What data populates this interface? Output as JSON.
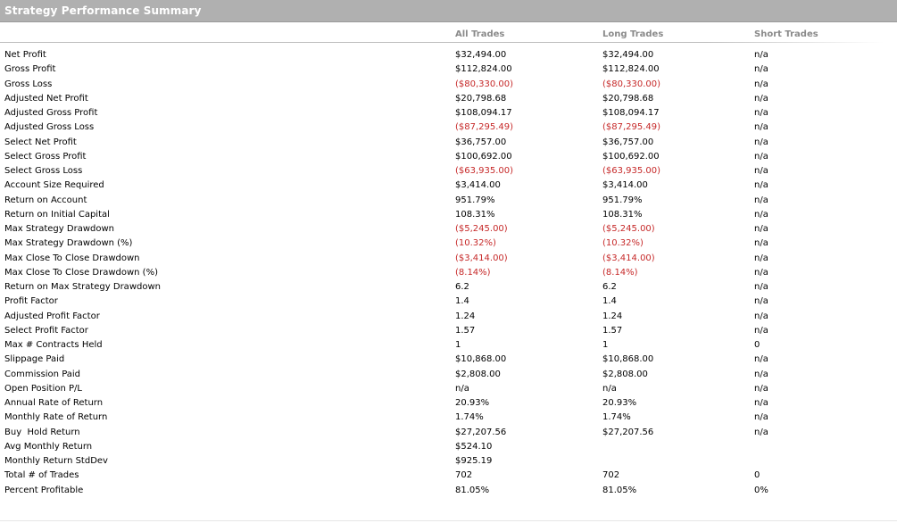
{
  "window": {
    "title": "Strategy Performance Summary"
  },
  "columns": [
    "All Trades",
    "Long Trades",
    "Short Trades"
  ],
  "rows": [
    {
      "label": "Net Profit",
      "all": "$32,494.00",
      "long": "$32,494.00",
      "short": "n/a",
      "negative": false
    },
    {
      "label": "Gross Profit",
      "all": "$112,824.00",
      "long": "$112,824.00",
      "short": "n/a",
      "negative": false
    },
    {
      "label": "Gross Loss",
      "all": "($80,330.00)",
      "long": "($80,330.00)",
      "short": "n/a",
      "negative": true
    },
    {
      "label": "Adjusted Net Profit",
      "all": "$20,798.68",
      "long": "$20,798.68",
      "short": "n/a",
      "negative": false
    },
    {
      "label": "Adjusted Gross Profit",
      "all": "$108,094.17",
      "long": "$108,094.17",
      "short": "n/a",
      "negative": false
    },
    {
      "label": "Adjusted Gross Loss",
      "all": "($87,295.49)",
      "long": "($87,295.49)",
      "short": "n/a",
      "negative": true
    },
    {
      "label": "Select Net Profit",
      "all": "$36,757.00",
      "long": "$36,757.00",
      "short": "n/a",
      "negative": false
    },
    {
      "label": "Select Gross Profit",
      "all": "$100,692.00",
      "long": "$100,692.00",
      "short": "n/a",
      "negative": false
    },
    {
      "label": "Select Gross Loss",
      "all": "($63,935.00)",
      "long": "($63,935.00)",
      "short": "n/a",
      "negative": true
    },
    {
      "label": "Account Size Required",
      "all": "$3,414.00",
      "long": "$3,414.00",
      "short": "n/a",
      "negative": false
    },
    {
      "label": "Return on Account",
      "all": "951.79%",
      "long": "951.79%",
      "short": "n/a",
      "negative": false
    },
    {
      "label": "Return on Initial Capital",
      "all": "108.31%",
      "long": "108.31%",
      "short": "n/a",
      "negative": false
    },
    {
      "label": "Max Strategy Drawdown",
      "all": "($5,245.00)",
      "long": "($5,245.00)",
      "short": "n/a",
      "negative": true
    },
    {
      "label": "Max Strategy Drawdown (%)",
      "all": "(10.32%)",
      "long": "(10.32%)",
      "short": "n/a",
      "negative": true
    },
    {
      "label": "Max Close To Close Drawdown",
      "all": "($3,414.00)",
      "long": "($3,414.00)",
      "short": "n/a",
      "negative": true
    },
    {
      "label": "Max Close To Close Drawdown (%)",
      "all": "(8.14%)",
      "long": "(8.14%)",
      "short": "n/a",
      "negative": true
    },
    {
      "label": "Return on Max Strategy Drawdown",
      "all": "6.2",
      "long": "6.2",
      "short": "n/a",
      "negative": false
    },
    {
      "label": "Profit Factor",
      "all": "1.4",
      "long": "1.4",
      "short": "n/a",
      "negative": false
    },
    {
      "label": "Adjusted Profit Factor",
      "all": "1.24",
      "long": "1.24",
      "short": "n/a",
      "negative": false
    },
    {
      "label": "Select Profit Factor",
      "all": "1.57",
      "long": "1.57",
      "short": "n/a",
      "negative": false
    },
    {
      "label": "Max # Contracts Held",
      "all": "1",
      "long": "1",
      "short": "0",
      "negative": false
    },
    {
      "label": "Slippage Paid",
      "all": "$10,868.00",
      "long": "$10,868.00",
      "short": "n/a",
      "negative": false
    },
    {
      "label": "Commission Paid",
      "all": "$2,808.00",
      "long": "$2,808.00",
      "short": "n/a",
      "negative": false
    },
    {
      "label": "Open Position P/L",
      "all": "n/a",
      "long": "n/a",
      "short": "n/a",
      "negative": false
    },
    {
      "label": "Annual Rate of Return",
      "all": "20.93%",
      "long": "20.93%",
      "short": "n/a",
      "negative": false
    },
    {
      "label": "Monthly Rate of Return",
      "all": "1.74%",
      "long": "1.74%",
      "short": "n/a",
      "negative": false
    },
    {
      "label": "Buy  Hold Return",
      "all": "$27,207.56",
      "long": "$27,207.56",
      "short": "n/a",
      "negative": false
    },
    {
      "label": "Avg Monthly Return",
      "all": "$524.10",
      "long": "",
      "short": "",
      "negative": false
    },
    {
      "label": "Monthly Return StdDev",
      "all": "$925.19",
      "long": "",
      "short": "",
      "negative": false
    },
    {
      "label": "Total # of Trades",
      "all": "702",
      "long": "702",
      "short": "0",
      "negative": false
    },
    {
      "label": "Percent Profitable",
      "all": "81.05%",
      "long": "81.05%",
      "short": "0%",
      "negative": false
    }
  ],
  "colors": {
    "negative": "#c62828",
    "header_bg": "#b0b0b0",
    "column_header": "#8a8a8a"
  }
}
